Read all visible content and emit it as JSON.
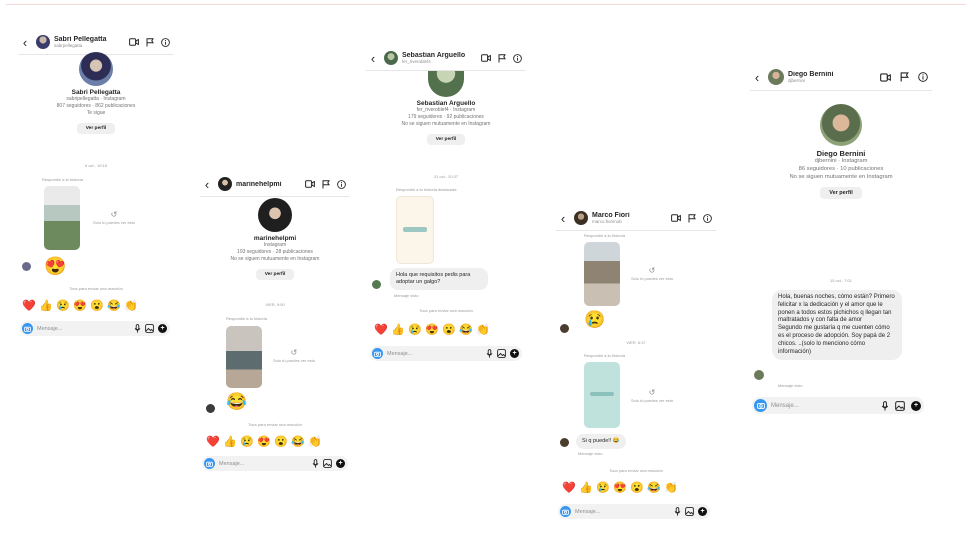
{
  "composer": {
    "placeholder": "Mensaje..."
  },
  "reaction_prompt": "Toca para enviar una reacción",
  "reel_unavailable": "Este reel ya no está disponible",
  "conversations": [
    {
      "header": {
        "name": "Sabri Pellegatta",
        "handle": "sabrpellegatta"
      },
      "profile": {
        "name": "Sabri Pellegatta",
        "lines": [
          "sabripellegatta · Instagram",
          "807 seguidores · 862 publicaciones",
          "Te sigue"
        ],
        "button": "Ver perfil"
      },
      "date": "6 oct., 19:15",
      "replied_label": "Respondió a tu historia",
      "reel_text": "Solo tú puedes ver esto"
    },
    {
      "header": {
        "name": "marinehelpmi",
        "handle": ""
      },
      "profile": {
        "name": "marinehelpmi",
        "lines": [
          "Instagram",
          "193 seguidores · 28 publicaciones",
          "No se siguen mutuamente en Instagram"
        ],
        "button": "Ver perfil"
      },
      "date": "VIER, 9:50",
      "replied_label": "Respondió a tu historia",
      "reel_text": "Solo tú puedes ver esto"
    },
    {
      "header": {
        "name": "Sebastian Arguello",
        "handle": "fer_riveroblef4"
      },
      "profile": {
        "name": "Sebastian Arguello",
        "lines": [
          "fer_riveroblef4 · Instagram",
          "179 seguidores · 92 publicaciones",
          "No se siguen mutuamente en Instagram"
        ],
        "button": "Ver perfil"
      },
      "date": "31 oct., 20:37",
      "replied_label": "Respondió a tu historia destacada",
      "message": "Hola que requisitos pedis para adoptar un galgo?",
      "seen_label": "Mensaje visto"
    },
    {
      "header": {
        "name": "Marco Fiori",
        "handle": "marco.fiorimob"
      },
      "date": "VIER, 6:37",
      "replied_label": "Respondió a tu historia",
      "reel_text": "Solo tú puedes ver esto",
      "message": "Si q puede!! 😂",
      "seen_label": "Mensaje visto"
    },
    {
      "header": {
        "name": "Diego Bernini",
        "handle": "djbernini"
      },
      "profile": {
        "name": "Diego Bernini",
        "lines": [
          "djbernini · Instagram",
          "86 seguidores · 10 publicaciones",
          "No se siguen mutuamente en Instagram"
        ],
        "button": "Ver perfil"
      },
      "date": "15 oct., 7:01",
      "message": "Hola, buenas noches, cómo están? Primero felicitar x la dedicación y el amor que le ponen a todos estos pichichos q llegan tan maltratados y con falta de amor\nSegundo me gustaría q me cuenten cómo es el proceso de adopción. Soy papá de 2 chicos. ..(solo lo menciono cómo información)",
      "seen_label": "Mensaje visto"
    }
  ],
  "reactions": [
    "❤️",
    "👍",
    "😢",
    "😍",
    "😮",
    "😂",
    "👏"
  ],
  "colors": {
    "accent": "#3797f0",
    "bubble": "#efefef",
    "text": "#262626",
    "muted": "#8e8e8e"
  },
  "icons": [
    "back-arrow-icon",
    "video-call-icon",
    "flag-icon",
    "info-icon",
    "camera-icon",
    "microphone-icon",
    "gallery-icon",
    "plus-icon",
    "reel-replay-icon"
  ]
}
